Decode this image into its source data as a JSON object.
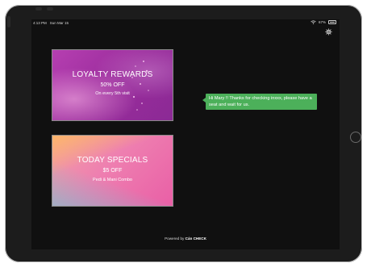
{
  "status_bar": {
    "time": "4:13 PM",
    "date": "Sun Mar 15",
    "battery": "67%"
  },
  "icons": {
    "wifi": "wifi-icon",
    "battery": "battery-icon",
    "settings": "gear-icon"
  },
  "cards": [
    {
      "title": "LOYALTY REWARDS",
      "line": "50% OFF",
      "sub": "On every 5th visit"
    },
    {
      "title": "TODAY SPECIALS",
      "line": "$5 OFF",
      "sub": "Pedi & Mani Combo"
    }
  ],
  "message": {
    "text": "Hi Mary !! Thanks for checking inxxx, please have a seat and wait for us."
  },
  "footer": {
    "powered_by": "Powered by",
    "brand": "Cán CHECK"
  },
  "colors": {
    "bubble": "#4cb05a",
    "loyalty": "#9a2c9c",
    "specials": "#ee7fb0"
  }
}
